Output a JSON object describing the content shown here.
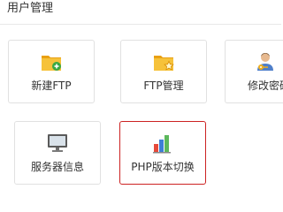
{
  "panel": {
    "title": "用户管理"
  },
  "tiles": [
    {
      "label": "新建FTP",
      "icon": "folder-add-icon"
    },
    {
      "label": "FTP管理",
      "icon": "folder-star-icon"
    },
    {
      "label": "修改密码",
      "icon": "user-key-icon"
    },
    {
      "label": "服务器信息",
      "icon": "monitor-icon"
    },
    {
      "label": "PHP版本切换",
      "icon": "bar-chart-icon",
      "selected": true
    }
  ],
  "colors": {
    "folder": "#f2b21a",
    "selection_border": "#cc2222"
  }
}
